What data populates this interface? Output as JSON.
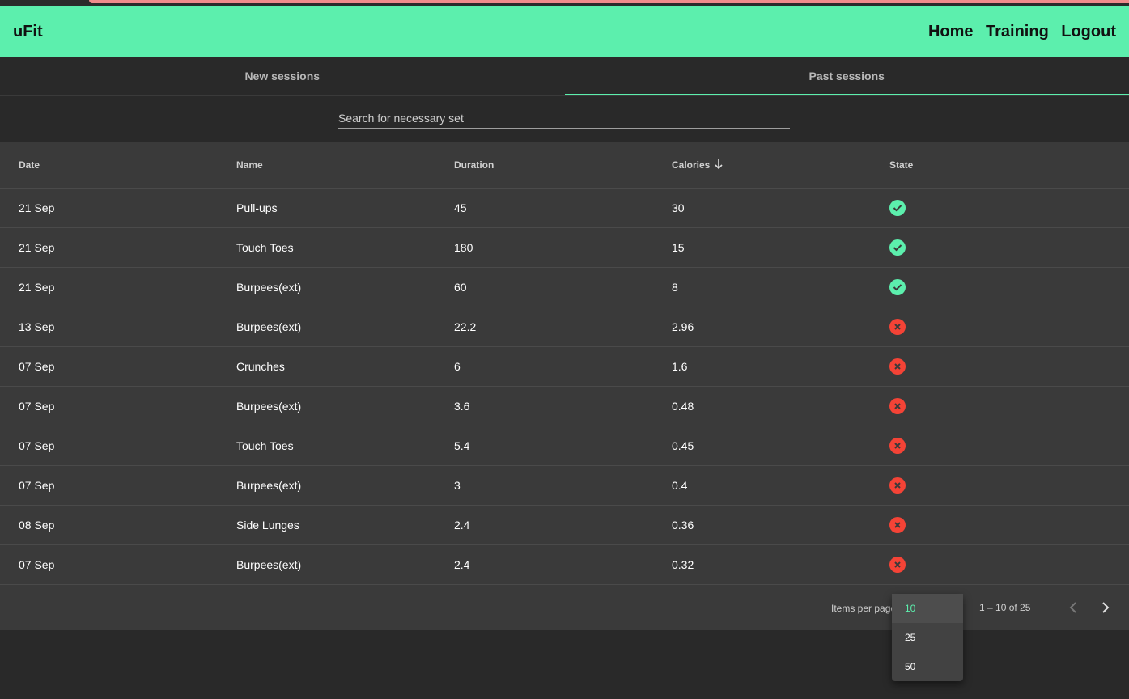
{
  "app": {
    "brand": "uFit"
  },
  "nav": {
    "home": "Home",
    "training": "Training",
    "logout": "Logout"
  },
  "tabs": [
    {
      "label": "New sessions"
    },
    {
      "label": "Past sessions"
    }
  ],
  "search": {
    "placeholder": "Search for necessary set"
  },
  "table": {
    "headers": {
      "date": "Date",
      "name": "Name",
      "duration": "Duration",
      "calories": "Calories",
      "state": "State"
    },
    "sort": {
      "column": "calories",
      "direction": "desc"
    },
    "rows": [
      {
        "date": "21 Sep",
        "name": "Pull-ups",
        "duration": "45",
        "calories": "30",
        "state": "completed"
      },
      {
        "date": "21 Sep",
        "name": "Touch Toes",
        "duration": "180",
        "calories": "15",
        "state": "completed"
      },
      {
        "date": "21 Sep",
        "name": "Burpees(ext)",
        "duration": "60",
        "calories": "8",
        "state": "completed"
      },
      {
        "date": "13 Sep",
        "name": "Burpees(ext)",
        "duration": "22.2",
        "calories": "2.96",
        "state": "cancelled"
      },
      {
        "date": "07 Sep",
        "name": "Crunches",
        "duration": "6",
        "calories": "1.6",
        "state": "cancelled"
      },
      {
        "date": "07 Sep",
        "name": "Burpees(ext)",
        "duration": "3.6",
        "calories": "0.48",
        "state": "cancelled"
      },
      {
        "date": "07 Sep",
        "name": "Touch Toes",
        "duration": "5.4",
        "calories": "0.45",
        "state": "cancelled"
      },
      {
        "date": "07 Sep",
        "name": "Burpees(ext)",
        "duration": "3",
        "calories": "0.4",
        "state": "cancelled"
      },
      {
        "date": "08 Sep",
        "name": "Side Lunges",
        "duration": "2.4",
        "calories": "0.36",
        "state": "cancelled"
      },
      {
        "date": "07 Sep",
        "name": "Burpees(ext)",
        "duration": "2.4",
        "calories": "0.32",
        "state": "cancelled"
      }
    ]
  },
  "paginator": {
    "items_per_page_label": "Items per page",
    "range_label": "1 – 10 of 25",
    "options": [
      "10",
      "25",
      "50"
    ],
    "selected": "10"
  },
  "colors": {
    "accent": "#5cefad",
    "error": "#f44336",
    "background": "#292929",
    "table_bg": "#3a3a3a"
  },
  "icons": {
    "ok": "check-circle-icon",
    "fail": "cancel-circle-icon",
    "sort": "arrow-down-icon",
    "prev": "chevron-left-icon",
    "next": "chevron-right-icon"
  }
}
